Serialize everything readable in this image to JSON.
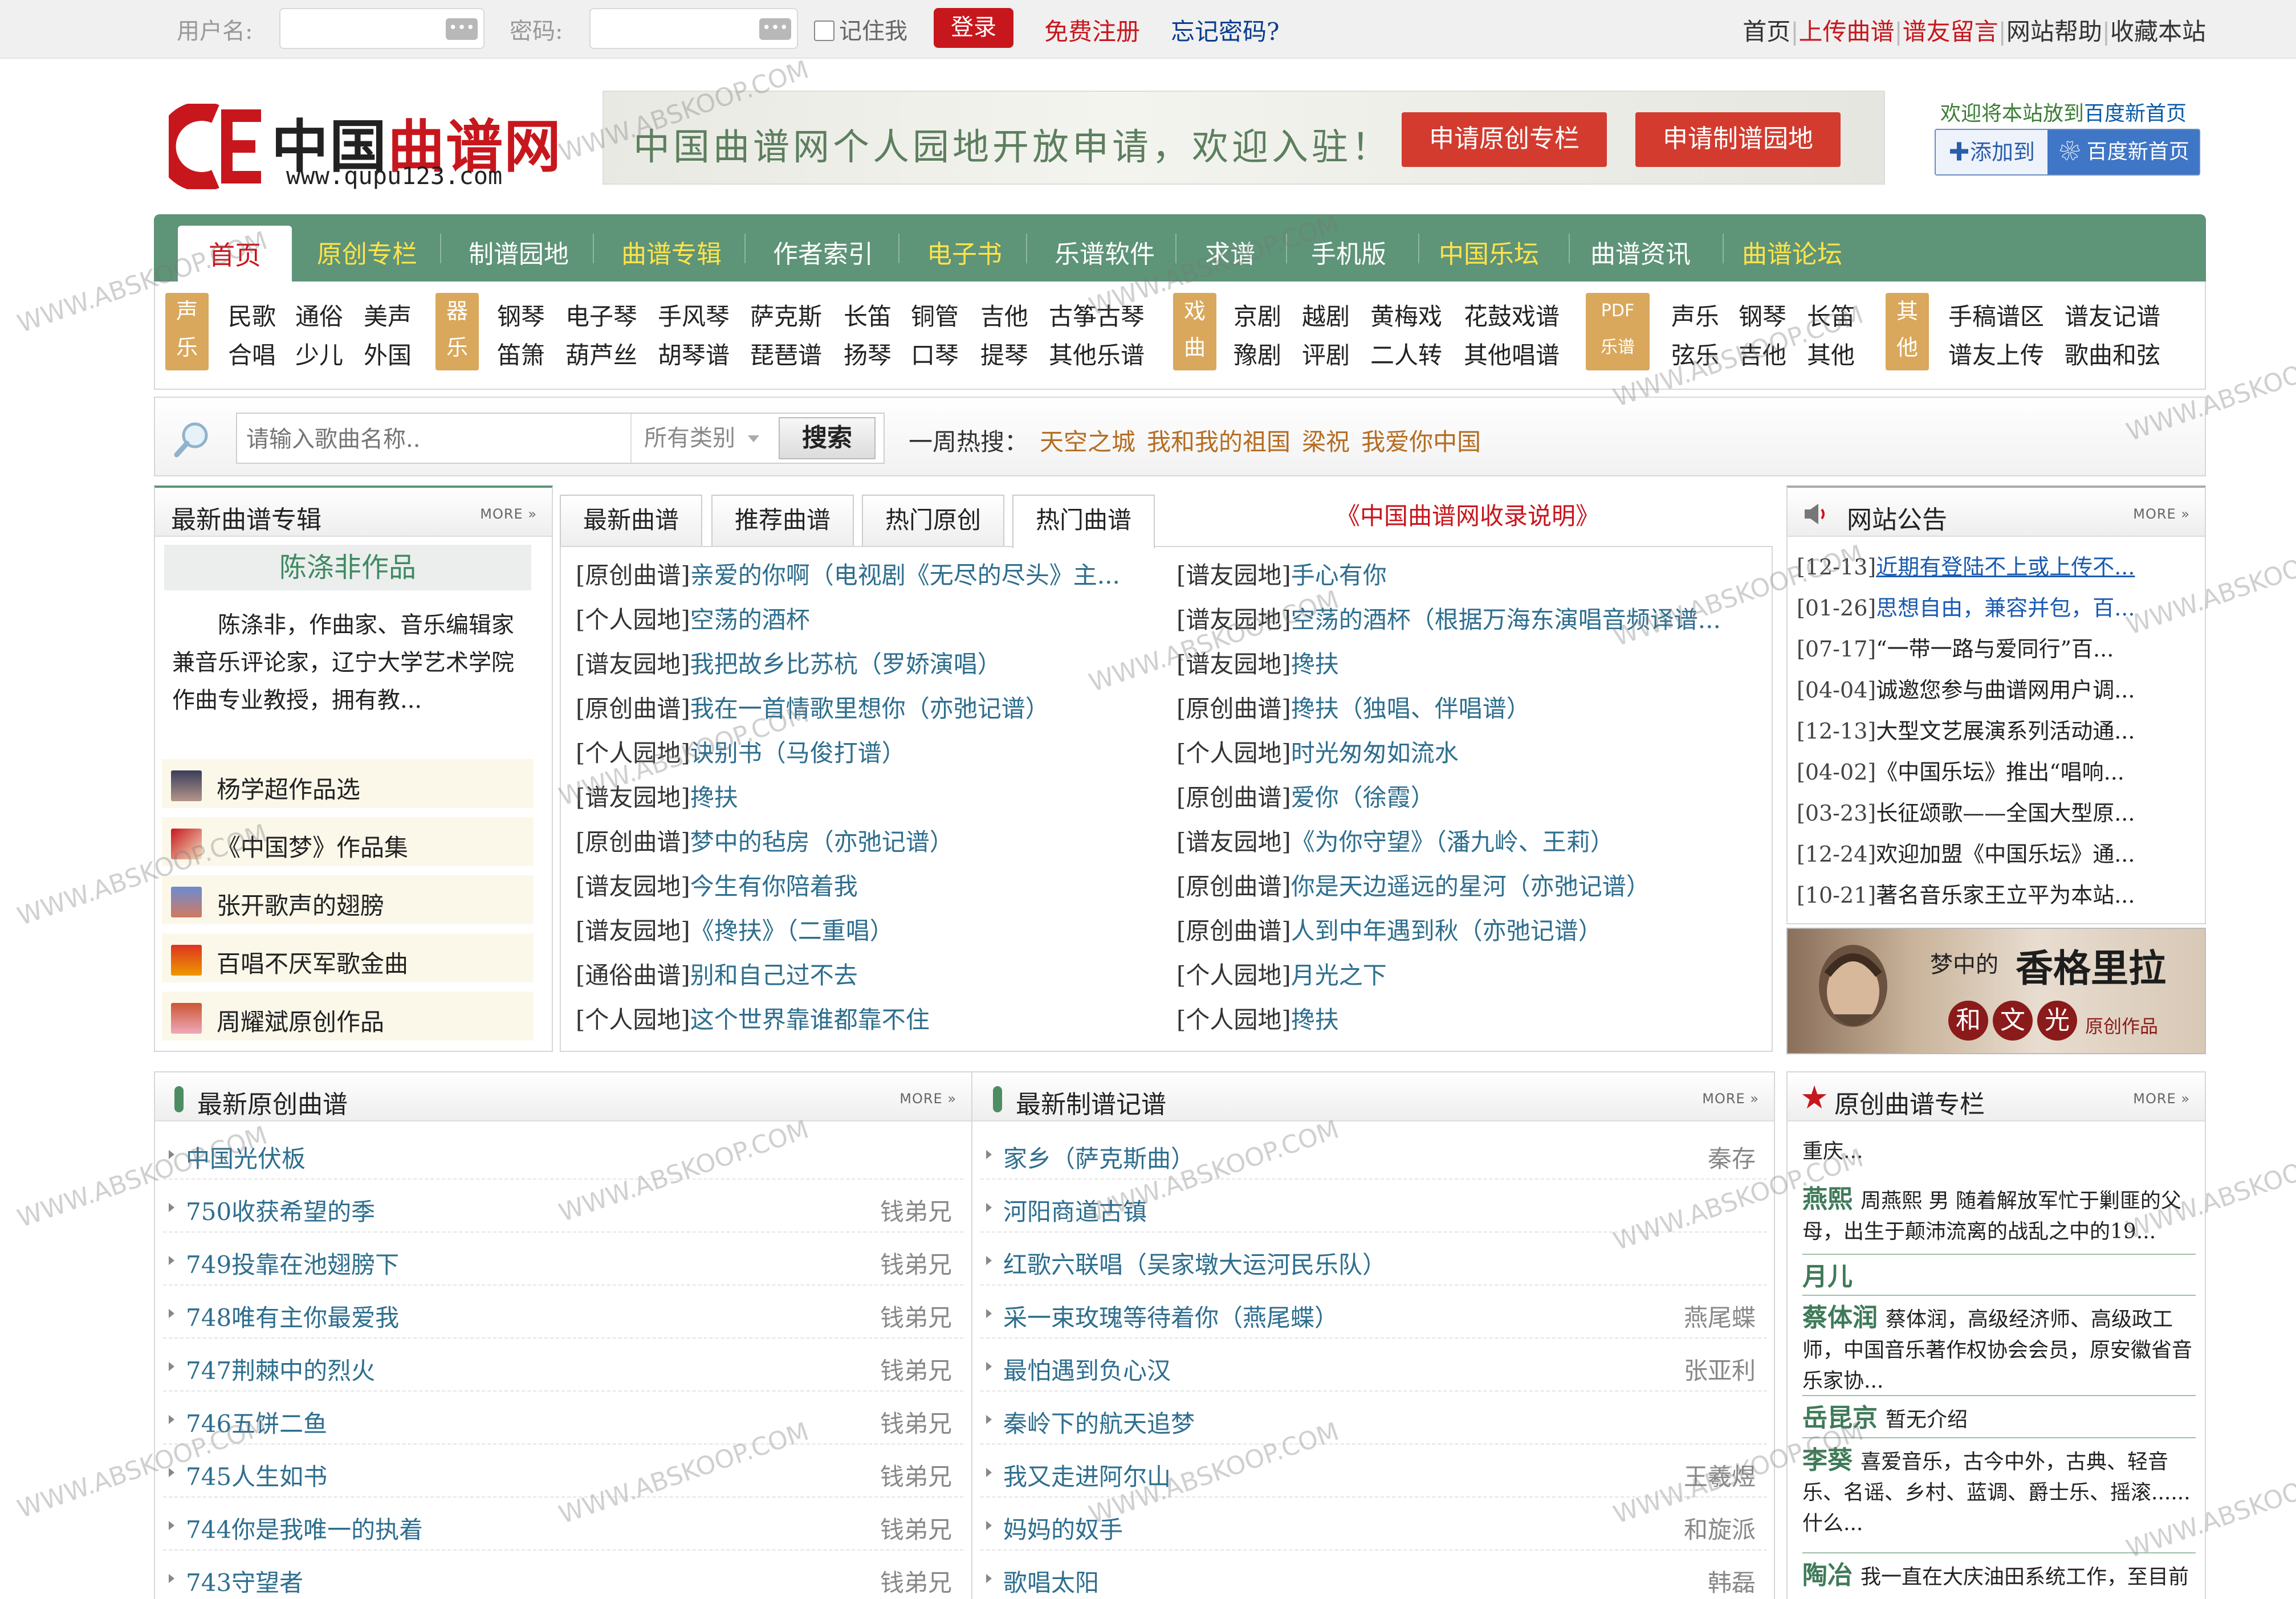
{
  "topbar": {
    "username_label": "用户名:",
    "password_label": "密码:",
    "remember": "记住我",
    "login": "登录",
    "register": "免费注册",
    "forgot": "忘记密码?",
    "links": [
      "首页",
      "上传曲谱",
      "谱友留言",
      "网站帮助",
      "收藏本站"
    ]
  },
  "logo": {
    "cn_red": "中国",
    "cn_dark": "曲谱网",
    "url": "www.qupu123.com"
  },
  "banner": {
    "text": "中国曲谱网个人园地开放申请，欢迎入驻！",
    "btn1": "申请原创专栏",
    "btn2": "申请制谱园地"
  },
  "welcome": {
    "text": "欢迎将本站放到",
    "link": "百度新首页",
    "add": "添加到",
    "baidu": "百度新首页"
  },
  "nav": [
    "首页",
    "原创专栏",
    "制谱园地",
    "曲谱专辑",
    "作者索引",
    "电子书",
    "乐谱软件",
    "求谱",
    "手机版",
    "中国乐坛",
    "曲谱资讯",
    "曲谱论坛"
  ],
  "cats": [
    {
      "tag": [
        "声",
        "乐"
      ],
      "row1": [
        "民歌",
        "通俗",
        "美声"
      ],
      "row2": [
        "合唱",
        "少儿",
        "外国"
      ]
    },
    {
      "tag": [
        "器",
        "乐"
      ],
      "row1": [
        "钢琴",
        "电子琴",
        "手风琴",
        "萨克斯",
        "长笛",
        "铜管",
        "吉他",
        "古筝古琴"
      ],
      "row2": [
        "笛箫",
        "葫芦丝",
        "胡琴谱",
        "琵琶谱",
        "扬琴",
        "口琴",
        "提琴",
        "其他乐谱"
      ]
    },
    {
      "tag": [
        "戏",
        "曲"
      ],
      "row1": [
        "京剧",
        "越剧",
        "黄梅戏",
        "花鼓戏谱"
      ],
      "row2": [
        "豫剧",
        "评剧",
        "二人转",
        "其他唱谱"
      ]
    },
    {
      "tag": [
        "PDF",
        "乐谱"
      ],
      "row1": [
        "声乐",
        "钢琴",
        "长笛"
      ],
      "row2": [
        "弦乐",
        "吉他",
        "其他"
      ]
    },
    {
      "tag": [
        "其",
        "他"
      ],
      "row1": [
        "手稿谱区",
        "谱友记谱"
      ],
      "row2": [
        "谱友上传",
        "歌曲和弦"
      ]
    }
  ],
  "search": {
    "placeholder": "请输入歌曲名称..",
    "category": "所有类别",
    "button": "搜索",
    "hot_label": "一周热搜：",
    "hot": [
      "天空之城",
      "我和我的祖国",
      "梁祝",
      "我爱你中国"
    ]
  },
  "album": {
    "title": "最新曲谱专辑",
    "more": "MORE »",
    "featured": "陈涤非作品",
    "desc": "陈涤非，作曲家、音乐编辑家兼音乐评论家，辽宁大学艺术学院作曲专业教授，拥有教...",
    "list": [
      "杨学超作品选",
      "《中国梦》作品集",
      "张开歌声的翅膀",
      "百唱不厌军歌金曲",
      "周耀斌原创作品"
    ]
  },
  "tabs": [
    "最新曲谱",
    "推荐曲谱",
    "热门原创",
    "热门曲谱"
  ],
  "notice": "《中国曲谱网收录说明》",
  "scores_left": [
    {
      "k": "[原创曲谱]",
      "v": "亲爱的你啊（电视剧《无尽的尽头》主..."
    },
    {
      "k": "[个人园地]",
      "v": "空荡的酒杯"
    },
    {
      "k": "[谱友园地]",
      "v": "我把故乡比苏杭（罗娇演唱）"
    },
    {
      "k": "[原创曲谱]",
      "v": "我在一首情歌里想你（亦弛记谱）"
    },
    {
      "k": "[个人园地]",
      "v": "诀别书（马俊打谱）"
    },
    {
      "k": "[谱友园地]",
      "v": "搀扶"
    },
    {
      "k": "[原创曲谱]",
      "v": "梦中的毡房（亦弛记谱）"
    },
    {
      "k": "[谱友园地]",
      "v": "今生有你陪着我"
    },
    {
      "k": "[谱友园地]",
      "v": "《搀扶》（二重唱）"
    },
    {
      "k": "[通俗曲谱]",
      "v": "别和自己过不去"
    },
    {
      "k": "[个人园地]",
      "v": "这个世界靠谁都靠不住"
    }
  ],
  "scores_right": [
    {
      "k": "[谱友园地]",
      "v": "手心有你"
    },
    {
      "k": "[谱友园地]",
      "v": "空荡的酒杯（根据万海东演唱音频译谱..."
    },
    {
      "k": "[谱友园地]",
      "v": "搀扶"
    },
    {
      "k": "[原创曲谱]",
      "v": "搀扶（独唱、伴唱谱）"
    },
    {
      "k": "[个人园地]",
      "v": "时光匆匆如流水"
    },
    {
      "k": "[原创曲谱]",
      "v": "爱你（徐霞）"
    },
    {
      "k": "[谱友园地]",
      "v": "《为你守望》（潘九岭、王莉）"
    },
    {
      "k": "[原创曲谱]",
      "v": "你是天边遥远的星河（亦弛记谱）"
    },
    {
      "k": "[原创曲谱]",
      "v": "人到中年遇到秋（亦弛记谱）"
    },
    {
      "k": "[个人园地]",
      "v": "月光之下"
    },
    {
      "k": "[个人园地]",
      "v": "搀扶"
    }
  ],
  "announce": {
    "title": "网站公告",
    "more": "MORE »",
    "items": [
      {
        "d": "[12-13]",
        "t": "近期有登陆不上或上传不..."
      },
      {
        "d": "[01-26]",
        "t": "思想自由，兼容并包，百..."
      },
      {
        "d": "[07-17]",
        "t": "“一带一路与爱同行”百..."
      },
      {
        "d": "[04-04]",
        "t": "诚邀您参与曲谱网用户调..."
      },
      {
        "d": "[12-13]",
        "t": "大型文艺展演系列活动通..."
      },
      {
        "d": "[04-02]",
        "t": "《中国乐坛》推出“唱响..."
      },
      {
        "d": "[03-23]",
        "t": "长征颂歌——全国大型原..."
      },
      {
        "d": "[12-24]",
        "t": "欢迎加盟《中国乐坛》通..."
      },
      {
        "d": "[10-21]",
        "t": "著名音乐家王立平为本站..."
      }
    ]
  },
  "ad": {
    "line1": "梦中的",
    "line2": "香格里拉",
    "chars": [
      "和",
      "文",
      "光"
    ],
    "sub": "原创作品"
  },
  "orig": {
    "title": "最新原创曲谱",
    "more": "MORE »",
    "items": [
      {
        "t": "中国光伏板",
        "a": ""
      },
      {
        "t": "750收获希望的季",
        "a": "钱弟兄"
      },
      {
        "t": "749投靠在池翅膀下",
        "a": "钱弟兄"
      },
      {
        "t": "748唯有主你最爱我",
        "a": "钱弟兄"
      },
      {
        "t": "747荆棘中的烈火",
        "a": "钱弟兄"
      },
      {
        "t": "746五饼二鱼",
        "a": "钱弟兄"
      },
      {
        "t": "745人生如书",
        "a": "钱弟兄"
      },
      {
        "t": "744你是我唯一的执着",
        "a": "钱弟兄"
      },
      {
        "t": "743守望者",
        "a": "钱弟兄"
      }
    ]
  },
  "made": {
    "title": "最新制谱记谱",
    "more": "MORE »",
    "items": [
      {
        "t": "家乡（萨克斯曲）",
        "a": "秦存"
      },
      {
        "t": "河阳商道古镇",
        "a": ""
      },
      {
        "t": "红歌六联唱（吴家墩大运河民乐队）",
        "a": ""
      },
      {
        "t": "采一束玫瑰等待着你（燕尾蝶）",
        "a": "燕尾蝶"
      },
      {
        "t": "最怕遇到负心汉",
        "a": "张亚利"
      },
      {
        "t": "秦岭下的航天追梦",
        "a": ""
      },
      {
        "t": "我又走进阿尔山",
        "a": "王羲煜"
      },
      {
        "t": "妈妈的奴手",
        "a": "和旋派"
      },
      {
        "t": "歌唱太阳",
        "a": "韩磊"
      }
    ]
  },
  "column": {
    "title": "原创曲谱专栏",
    "more": "MORE »",
    "top": "重庆...",
    "items": [
      {
        "n": "燕熙",
        "t": "周燕熙 男 随着解放军忙于剿匪的父母，出生于颠沛流离的战乱之中的19..."
      },
      {
        "n": "月儿",
        "t": ""
      },
      {
        "n": "蔡体润",
        "t": "蔡体润，高级经济师、高级政工师，中国音乐著作权协会会员，原安徽省音乐家协..."
      },
      {
        "n": "岳昆京",
        "t": "暂无介绍"
      },
      {
        "n": "李葵",
        "t": "喜爱音乐，古今中外，古典、轻音乐、名谣、乡村、蓝调、爵士乐、摇滚......什么..."
      },
      {
        "n": "陶冶",
        "t": "我一直在大庆油田系统工作，至目前"
      }
    ]
  },
  "watermark": "WWW.ABSKOOP.COM",
  "colors": {
    "red": "#c8161d",
    "nav_green": "#5e9478",
    "link_blue": "#2e6e8e",
    "tag_orange": "#d9a85c"
  }
}
